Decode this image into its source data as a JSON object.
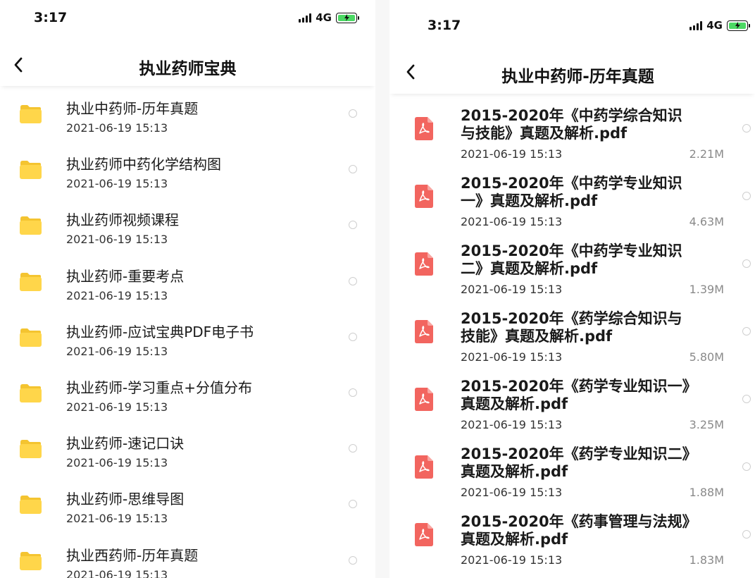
{
  "left": {
    "status": {
      "time": "3:17",
      "network": "4G"
    },
    "title": "执业药师宝典",
    "items": [
      {
        "name": "执业中药师-历年真题",
        "date": "2021-06-19 15:13"
      },
      {
        "name": "执业药师中药化学结构图",
        "date": "2021-06-19 15:13"
      },
      {
        "name": "执业药师视频课程",
        "date": "2021-06-19 15:13"
      },
      {
        "name": "执业药师-重要考点",
        "date": "2021-06-19 15:13"
      },
      {
        "name": "执业药师-应试宝典PDF电子书",
        "date": "2021-06-19 15:13"
      },
      {
        "name": "执业药师-学习重点+分值分布",
        "date": "2021-06-19 15:13"
      },
      {
        "name": "执业药师-速记口诀",
        "date": "2021-06-19 15:13"
      },
      {
        "name": "执业药师-思维导图",
        "date": "2021-06-19 15:13"
      },
      {
        "name": "执业西药师-历年真题",
        "date": "2021-06-19 15:13"
      }
    ]
  },
  "right": {
    "status": {
      "time": "3:17",
      "network": "4G"
    },
    "title": "执业中药师-历年真题",
    "items": [
      {
        "name": "2015-2020年《中药学综合知识与技能》真题及解析.pdf",
        "date": "2021-06-19 15:13",
        "size": "2.21M"
      },
      {
        "name": "2015-2020年《中药学专业知识一》真题及解析.pdf",
        "date": "2021-06-19 15:13",
        "size": "4.63M"
      },
      {
        "name": "2015-2020年《中药学专业知识二》真题及解析.pdf",
        "date": "2021-06-19 15:13",
        "size": "1.39M"
      },
      {
        "name": "2015-2020年《药学综合知识与技能》真题及解析.pdf",
        "date": "2021-06-19 15:13",
        "size": "5.80M"
      },
      {
        "name": "2015-2020年《药学专业知识一》真题及解析.pdf",
        "date": "2021-06-19 15:13",
        "size": "3.25M"
      },
      {
        "name": "2015-2020年《药学专业知识二》真题及解析.pdf",
        "date": "2021-06-19 15:13",
        "size": "1.88M"
      },
      {
        "name": "2015-2020年《药事管理与法规》真题及解析.pdf",
        "date": "2021-06-19 15:13",
        "size": "1.83M"
      }
    ]
  },
  "icons": {
    "folder": "folder-icon",
    "pdf": "pdf-file-icon",
    "back": "chevron-left-icon",
    "select": "radio-unchecked-icon"
  },
  "colors": {
    "folder": "#FFD64A",
    "pdf": "#F2655F",
    "battery": "#4CD964",
    "radio": "#CFCFCF"
  }
}
